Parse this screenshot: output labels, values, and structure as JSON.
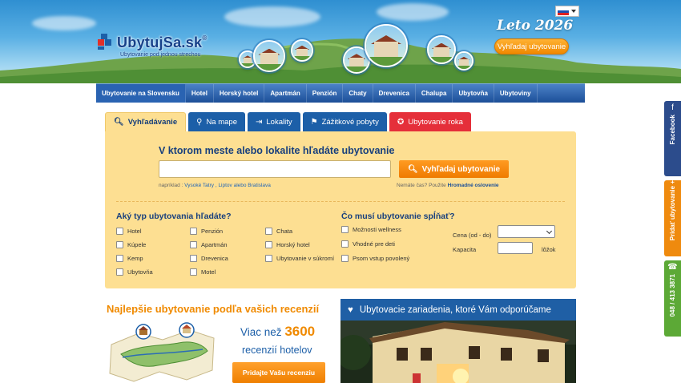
{
  "header": {
    "logo_text": "UbytujSa.sk",
    "logo_reg": "®",
    "logo_tagline": "Ubytovanie pod jednou strechou",
    "season": "Leto 2026",
    "search_button": "Vyhľadaj ubytovanie",
    "language_flag": "slovak-flag-icon"
  },
  "nav": {
    "items": [
      {
        "label": "Ubytovanie na Slovensku",
        "active": true
      },
      {
        "label": "Hotel"
      },
      {
        "label": "Horský hotel"
      },
      {
        "label": "Apartmán"
      },
      {
        "label": "Penzión"
      },
      {
        "label": "Chaty"
      },
      {
        "label": "Drevenica"
      },
      {
        "label": "Chalupa"
      },
      {
        "label": "Ubytovňa"
      },
      {
        "label": "Ubytoviny"
      }
    ]
  },
  "tabs": [
    {
      "label": "Vyhľadávanie",
      "icon": "search-icon"
    },
    {
      "label": "Na mape",
      "icon": "map-pin-icon"
    },
    {
      "label": "Lokality",
      "icon": "signpost-icon"
    },
    {
      "label": "Zážitkové pobyty",
      "icon": "flag-icon"
    },
    {
      "label": "Ubytovanie roka",
      "icon": "award-icon"
    }
  ],
  "search": {
    "title": "V ktorom meste alebo lokalite hľadáte ubytovanie",
    "input_value": "",
    "button": "Vyhľadaj ubytovanie",
    "hint_prefix": "napríklad :",
    "hint_example": "Vysoké Tatry , Liptov alebo Bratislava",
    "no_time_prefix": "Nemáte čas? Použite",
    "no_time_link": "Hromadné oslovenie"
  },
  "filters": {
    "type_title": "Aký typ ubytovania hľadáte?",
    "types": [
      "Hotel",
      "Kúpele",
      "Kemp",
      "Ubytovňa",
      "Penzión",
      "Apartmán",
      "Drevenica",
      "Motel",
      "Chata",
      "Horský hotel",
      "Ubytovanie v súkromí"
    ],
    "req_title": "Čo musí ubytovanie spĺňať?",
    "requirements": [
      "Možnosti wellness",
      "Vhodné pre deti",
      "Psom vstup povolený"
    ],
    "price_label": "Cena (od - do)",
    "capacity_label": "Kapacita",
    "capacity_unit": "lôžok"
  },
  "reviews": {
    "title": "Najlepšie ubytovanie podľa vašich recenzií",
    "count_prefix": "Viac než",
    "count": "3600",
    "count_suffix": "recenzií hotelov",
    "button": "Pridajte Vašu recenziu"
  },
  "recommend": {
    "title": "Ubytovacie zariadenia, ktoré Vám odporúčame"
  },
  "side": {
    "facebook": "Facebook",
    "add": "Pridať ubytovanie +",
    "phone": "048 / 413 3871"
  },
  "colors": {
    "nav_blue": "#1c4f98",
    "search_bg": "#fddf92",
    "orange": "#f08a00",
    "title_blue": "#173f7d",
    "red_tab": "#e52f3a"
  }
}
